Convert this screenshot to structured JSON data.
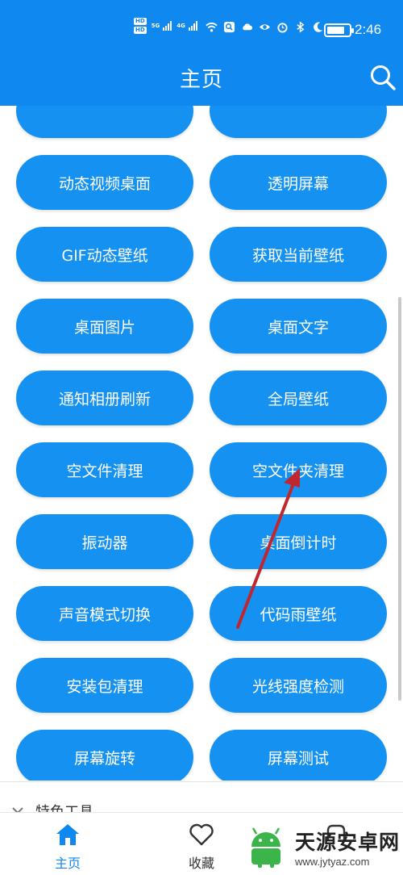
{
  "status_bar": {
    "time": "2:46",
    "hd_badges": [
      "HD",
      "HD"
    ],
    "network_labels": [
      "5G",
      "4G"
    ],
    "battery_level": 0.8,
    "icons": [
      "signal-icon",
      "wifi-icon",
      "search-badge-icon",
      "cloud-icon",
      "eye-icon",
      "alarm-icon",
      "bluetooth-icon",
      "moon-icon",
      "battery-icon"
    ]
  },
  "header": {
    "title": "主页",
    "background": "#0f88f0",
    "search_icon": "search-icon"
  },
  "tools": [
    {
      "left": "",
      "right": ""
    },
    {
      "left": "动态视频桌面",
      "right": "透明屏幕"
    },
    {
      "left": "GIF动态壁纸",
      "right": "获取当前壁纸"
    },
    {
      "left": "桌面图片",
      "right": "桌面文字"
    },
    {
      "left": "通知相册刷新",
      "right": "全局壁纸"
    },
    {
      "left": "空文件清理",
      "right": "空文件夹清理"
    },
    {
      "left": "振动器",
      "right": "桌面倒计时"
    },
    {
      "left": "声音模式切换",
      "right": "代码雨壁纸"
    },
    {
      "left": "安装包清理",
      "right": "光线强度检测"
    },
    {
      "left": "屏幕旋转",
      "right": "屏幕测试"
    }
  ],
  "button_color": "#1592f1",
  "section": {
    "title": "特色工具",
    "chevron_icon": "chevron-down-icon"
  },
  "bottom_nav": [
    {
      "label": "主页",
      "icon": "home-icon",
      "active": true
    },
    {
      "label": "收藏",
      "icon": "heart-icon",
      "active": false
    }
  ],
  "annotation": {
    "arrow_color": "#c0262d",
    "points_to": "空文件夹清理"
  },
  "watermark": {
    "title": "天源安卓网",
    "url": "www.jytyaz.com"
  }
}
